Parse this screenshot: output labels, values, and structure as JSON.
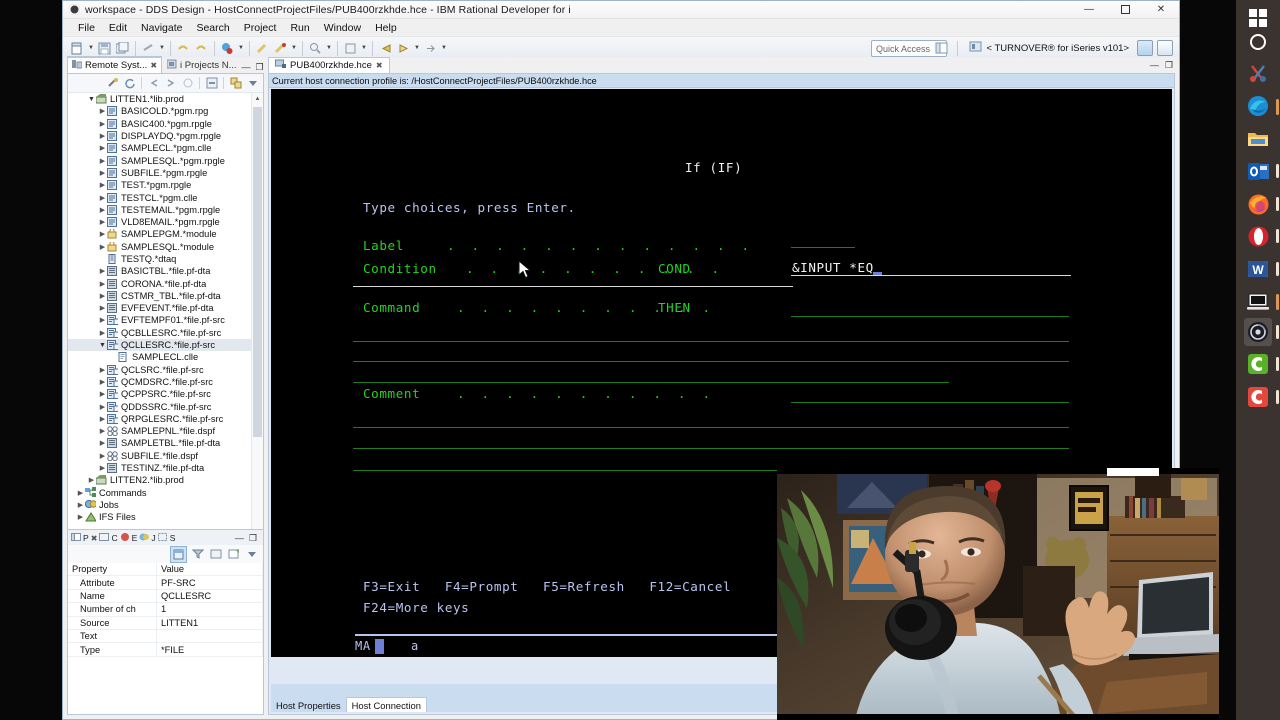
{
  "window": {
    "title": "workspace - DDS Design - HostConnectProjectFiles/PUB400rzkhde.hce - IBM Rational Developer for i",
    "app_icon": "rdi-circle-icon",
    "controls": {
      "minimize": "—",
      "maximize": "❐",
      "close": "✕"
    }
  },
  "menubar": {
    "items": [
      "File",
      "Edit",
      "Navigate",
      "Search",
      "Project",
      "Run",
      "Window",
      "Help"
    ]
  },
  "toolbar": {
    "quick_access_placeholder": "Quick Access",
    "perspective_label": "< TURNOVER® for iSeries v101>",
    "icons": [
      "new-file-icon",
      "save-icon",
      "save-all-icon",
      "print-icon",
      "undo-icon",
      "redo-icon",
      "debug-icon",
      "build-icon",
      "run-icon",
      "search-icon",
      "history-icon",
      "back-icon",
      "forward-icon",
      "next-icon"
    ]
  },
  "left_panel": {
    "tabs": [
      {
        "label": "Remote Syst...",
        "icon": "remote-systems-icon",
        "active": true,
        "close": "✖"
      },
      {
        "label": "i Projects N...",
        "icon": "i-projects-icon",
        "active": false
      }
    ],
    "view_controls": [
      "minimize-view-icon",
      "maximize-view-icon"
    ],
    "toolbar_icons": [
      "connect-icon",
      "refresh-icon",
      "back-icon",
      "forward-icon",
      "up-icon",
      "collapse-all-icon",
      "link-editor-icon",
      "view-menu-icon"
    ],
    "tree": [
      {
        "label": "LITTEN1.*lib.prod",
        "depth": 1,
        "twisty": "open",
        "icon": "library-icon",
        "selected": false
      },
      {
        "label": "BASICOLD.*pgm.rpg",
        "depth": 2,
        "twisty": "closed",
        "icon": "program-icon",
        "selected": false
      },
      {
        "label": "BASIC400.*pgm.rpgle",
        "depth": 2,
        "twisty": "closed",
        "icon": "program-icon",
        "selected": false
      },
      {
        "label": "DISPLAYDQ.*pgm.rpgle",
        "depth": 2,
        "twisty": "closed",
        "icon": "program-icon",
        "selected": false
      },
      {
        "label": "SAMPLECL.*pgm.clle",
        "depth": 2,
        "twisty": "closed",
        "icon": "program-icon",
        "selected": false
      },
      {
        "label": "SAMPLESQL.*pgm.rpgle",
        "depth": 2,
        "twisty": "closed",
        "icon": "program-icon",
        "selected": false
      },
      {
        "label": "SUBFILE.*pgm.rpgle",
        "depth": 2,
        "twisty": "closed",
        "icon": "program-icon",
        "selected": false
      },
      {
        "label": "TEST.*pgm.rpgle",
        "depth": 2,
        "twisty": "closed",
        "icon": "program-icon",
        "selected": false
      },
      {
        "label": "TESTCL.*pgm.clle",
        "depth": 2,
        "twisty": "closed",
        "icon": "program-icon",
        "selected": false
      },
      {
        "label": "TESTEMAIL.*pgm.rpgle",
        "depth": 2,
        "twisty": "closed",
        "icon": "program-icon",
        "selected": false
      },
      {
        "label": "VLD8EMAIL.*pgm.rpgle",
        "depth": 2,
        "twisty": "closed",
        "icon": "program-icon",
        "selected": false
      },
      {
        "label": "SAMPLEPGM.*module",
        "depth": 2,
        "twisty": "closed",
        "icon": "module-icon",
        "selected": false
      },
      {
        "label": "SAMPLESQL.*module",
        "depth": 2,
        "twisty": "closed",
        "icon": "module-icon",
        "selected": false
      },
      {
        "label": "TESTQ.*dtaq",
        "depth": 2,
        "twisty": "none",
        "icon": "dataqueue-icon",
        "selected": false
      },
      {
        "label": "BASICTBL.*file.pf-dta",
        "depth": 2,
        "twisty": "closed",
        "icon": "pfdta-icon",
        "selected": false
      },
      {
        "label": "CORONA.*file.pf-dta",
        "depth": 2,
        "twisty": "closed",
        "icon": "pfdta-icon",
        "selected": false
      },
      {
        "label": "CSTMR_TBL.*file.pf-dta",
        "depth": 2,
        "twisty": "closed",
        "icon": "pfdta-icon",
        "selected": false
      },
      {
        "label": "EVFEVENT.*file.pf-dta",
        "depth": 2,
        "twisty": "closed",
        "icon": "pfdta-icon",
        "selected": false
      },
      {
        "label": "EVFTEMPF01.*file.pf-src",
        "depth": 2,
        "twisty": "closed",
        "icon": "pfsrc-icon",
        "selected": false
      },
      {
        "label": "QCBLLESRC.*file.pf-src",
        "depth": 2,
        "twisty": "closed",
        "icon": "pfsrc-icon",
        "selected": false
      },
      {
        "label": "QCLLESRC.*file.pf-src",
        "depth": 2,
        "twisty": "open",
        "icon": "pfsrc-icon",
        "selected": true
      },
      {
        "label": "SAMPLECL.clle",
        "depth": 3,
        "twisty": "none",
        "icon": "member-icon",
        "selected": false
      },
      {
        "label": "QCLSRC.*file.pf-src",
        "depth": 2,
        "twisty": "closed",
        "icon": "pfsrc-icon",
        "selected": false
      },
      {
        "label": "QCMDSRC.*file.pf-src",
        "depth": 2,
        "twisty": "closed",
        "icon": "pfsrc-icon",
        "selected": false
      },
      {
        "label": "QCPPSRC.*file.pf-src",
        "depth": 2,
        "twisty": "closed",
        "icon": "pfsrc-icon",
        "selected": false
      },
      {
        "label": "QDDSSRC.*file.pf-src",
        "depth": 2,
        "twisty": "closed",
        "icon": "pfsrc-icon",
        "selected": false
      },
      {
        "label": "QRPGLESRC.*file.pf-src",
        "depth": 2,
        "twisty": "closed",
        "icon": "pfsrc-icon",
        "selected": false
      },
      {
        "label": "SAMPLEPNL.*file.dspf",
        "depth": 2,
        "twisty": "closed",
        "icon": "dspf-icon",
        "selected": false
      },
      {
        "label": "SAMPLETBL.*file.pf-dta",
        "depth": 2,
        "twisty": "closed",
        "icon": "pfdta-icon",
        "selected": false
      },
      {
        "label": "SUBFILE.*file.dspf",
        "depth": 2,
        "twisty": "closed",
        "icon": "dspf-icon",
        "selected": false
      },
      {
        "label": "TESTINZ.*file.pf-dta",
        "depth": 2,
        "twisty": "closed",
        "icon": "pfdta-icon",
        "selected": false
      },
      {
        "label": "LITTEN2.*lib.prod",
        "depth": 1,
        "twisty": "closed",
        "icon": "library-icon",
        "selected": false
      },
      {
        "label": "Commands",
        "depth": 0,
        "twisty": "closed",
        "icon": "commands-icon",
        "selected": false
      },
      {
        "label": "Jobs",
        "depth": 0,
        "twisty": "closed",
        "icon": "jobs-icon",
        "selected": false
      },
      {
        "label": "IFS Files",
        "depth": 0,
        "twisty": "closed",
        "icon": "ifs-icon",
        "selected": false
      }
    ]
  },
  "properties_panel": {
    "tabs": [
      {
        "letter": "P",
        "icon": "properties-icon",
        "close": "✖"
      },
      {
        "letter": "C",
        "icon": "console-icon"
      },
      {
        "letter": "E",
        "icon": "error-log-icon"
      },
      {
        "letter": "J",
        "icon": "jobs-icon"
      },
      {
        "letter": "S",
        "icon": "search-results-icon"
      }
    ],
    "view_controls": [
      "minimize-view-icon",
      "maximize-view-icon"
    ],
    "toolbar_icons": [
      "show-categories-icon",
      "filter-icon",
      "restore-defaults-icon",
      "new-window-icon",
      "view-menu-icon"
    ],
    "columns": [
      "Property",
      "Value"
    ],
    "rows": [
      {
        "property": "Attribute",
        "value": "PF-SRC"
      },
      {
        "property": "Name",
        "value": "QCLLESRC"
      },
      {
        "property": "Number of ch",
        "value": "1"
      },
      {
        "property": "Source",
        "value": "LITTEN1"
      },
      {
        "property": "Text",
        "value": ""
      },
      {
        "property": "Type",
        "value": "*FILE"
      }
    ]
  },
  "editor": {
    "tab": {
      "label": "PUB400rzkhde.hce",
      "icon": "host-connection-icon",
      "close": "✖"
    },
    "tab_controls": [
      "minimize-editor-icon",
      "maximize-editor-icon"
    ],
    "host_profile_bar": "Current host connection profile is: /HostConnectProjectFiles/PUB400rzkhde.hce",
    "bottom_tabs": [
      {
        "label": "Host Properties",
        "active": false
      },
      {
        "label": "Host Connection",
        "active": true
      }
    ]
  },
  "terminal": {
    "title": "If (IF)",
    "instruction": "Type choices, press Enter.",
    "fields": [
      {
        "label": "Label",
        "dots": ".  .  .  .  .  .  .  .  .  .  .  .  .",
        "keyword": ""
      },
      {
        "label": "Condition",
        "dots": ".  .  .  .  .  .  .  .  .  .  .",
        "keyword": "COND"
      },
      {
        "label": "Command",
        "dots": ".  .  .  .  .  .  .  .  .  .  .",
        "keyword": "THEN"
      },
      {
        "label": "Comment",
        "dots": ".  .  .  .  .  .  .  .  .  .  .",
        "keyword": ""
      }
    ],
    "cond_value": "&INPUT *EQ",
    "function_keys_line1": "F3=Exit   F4=Prompt   F5=Refresh   F12=Cancel",
    "function_keys_line2": "F24=More keys",
    "status_indicator": "MA",
    "status_extra": "a"
  },
  "taskbar": {
    "icons": [
      {
        "name": "windows-start-icon",
        "running": false,
        "active": false
      },
      {
        "name": "cortana-search-icon",
        "running": false,
        "active": false
      },
      {
        "name": "snipping-tool-icon",
        "running": false,
        "active": false
      },
      {
        "name": "microsoft-edge-icon",
        "running": true,
        "active": false
      },
      {
        "name": "file-explorer-icon",
        "running": false,
        "active": false
      },
      {
        "name": "outlook-icon",
        "running": true,
        "active": false
      },
      {
        "name": "firefox-icon",
        "running": true,
        "active": false
      },
      {
        "name": "opera-icon",
        "running": true,
        "active": false
      },
      {
        "name": "microsoft-word-icon",
        "running": true,
        "active": false
      },
      {
        "name": "remote-desktop-icon",
        "running": true,
        "active": false
      },
      {
        "name": "obs-studio-icon",
        "running": true,
        "active": true
      },
      {
        "name": "camtasia-icon",
        "running": true,
        "active": false
      },
      {
        "name": "camtasia-recorder-icon",
        "running": true,
        "active": false
      }
    ]
  },
  "colors": {
    "terminal_green": "#22d422",
    "terminal_white": "#f2f2f2",
    "terminal_blue": "#b9c4ee",
    "terminal_bg": "#000000",
    "accent_blue": "#c9dcf0",
    "taskbar_bg": "#3b3330"
  }
}
